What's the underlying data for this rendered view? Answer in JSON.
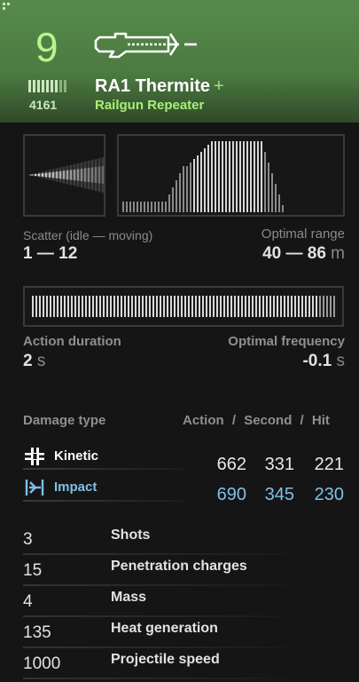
{
  "header": {
    "level": "9",
    "power": "4161",
    "weapon_name": "RA1 Thermite",
    "plus": "+",
    "weapon_type": "Railgun Repeater",
    "weapon_icon": "railgun-icon",
    "power_icon": "power-bars-icon",
    "accent_color": "#a8f077",
    "header_color": "#578a4a"
  },
  "scatter": {
    "label": "Scatter (idle — moving)",
    "value": "1 — 12",
    "icon": "scatter-cone-icon"
  },
  "optimal_range": {
    "label": "Optimal range",
    "value": "40 — 86",
    "unit": "m"
  },
  "action_duration": {
    "label": "Action duration",
    "value": "2",
    "unit": "s"
  },
  "optimal_frequency": {
    "label": "Optimal frequency",
    "value": "-0.1",
    "unit": "s"
  },
  "damage": {
    "header_type": "Damage type",
    "col_action": "Action",
    "sep1": "/",
    "col_second": "Second",
    "sep2": "/",
    "col_hit": "Hit",
    "rows": [
      {
        "name": "Kinetic",
        "icon": "kinetic-icon",
        "color": "#ffffff",
        "action": "662",
        "second": "331",
        "hit": "221"
      },
      {
        "name": "Impact",
        "icon": "impact-icon",
        "color": "#7fc0e8",
        "action": "690",
        "second": "345",
        "hit": "230"
      }
    ]
  },
  "stats": [
    {
      "value": "3",
      "name": "Shots"
    },
    {
      "value": "15",
      "name": "Penetration charges"
    },
    {
      "value": "4",
      "name": "Mass"
    },
    {
      "value": "135",
      "name": "Heat generation"
    },
    {
      "value": "1000",
      "name": "Projectile speed"
    }
  ]
}
